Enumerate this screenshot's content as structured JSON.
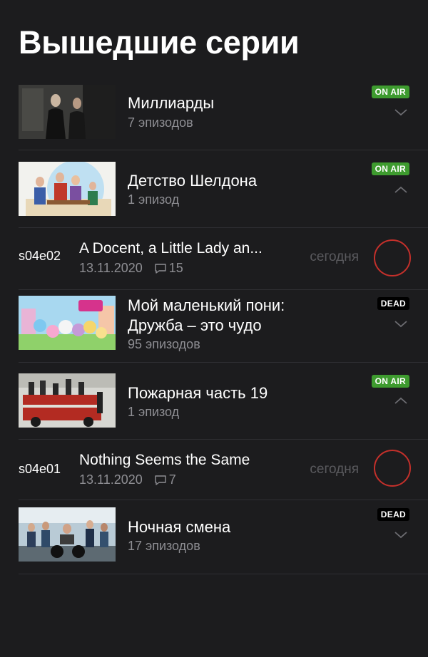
{
  "page_title": "Вышедшие серии",
  "shows": [
    {
      "title": "Миллиарды",
      "subtitle": "7 эпизодов",
      "badge": "ON AIR",
      "chevron": "chevron-down"
    },
    {
      "title": "Детство Шелдона",
      "subtitle": "1 эпизод",
      "badge": "ON AIR",
      "chevron": "chevron-up"
    },
    {
      "title_line1": "Мой маленький пони:",
      "title_line2": "Дружба – это чудо",
      "subtitle": "95 эпизодов",
      "badge": "DEAD",
      "chevron": "chevron-down"
    },
    {
      "title": "Пожарная часть 19",
      "subtitle": "1 эпизод",
      "badge": "ON AIR",
      "chevron": "chevron-up"
    },
    {
      "title": "Ночная смена",
      "subtitle": "17 эпизодов",
      "badge": "DEAD",
      "chevron": "chevron-down"
    }
  ],
  "episodes": [
    {
      "code": "s04e02",
      "title": "A Docent, a Little Lady an...",
      "date": "13.11.2020",
      "comments": "15",
      "when": "сегодня"
    },
    {
      "code": "s04e01",
      "title": "Nothing Seems the Same",
      "date": "13.11.2020",
      "comments": "7",
      "when": "сегодня"
    }
  ],
  "colors": {
    "background": "#1c1c1e",
    "on_air": "#3e9b2f",
    "dead": "#000000",
    "watch_ring": "#c4302b",
    "secondary_text": "#8e8e93"
  }
}
